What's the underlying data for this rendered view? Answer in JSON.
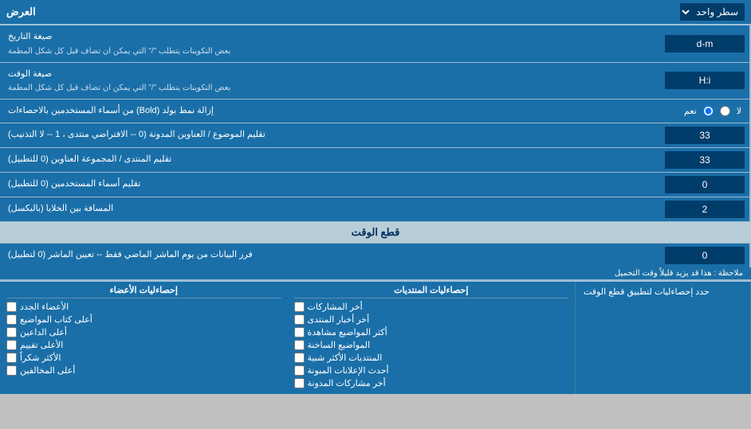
{
  "header": {
    "label": "العرض",
    "dropdown_label": "سطر واحد"
  },
  "rows": [
    {
      "id": "date-format",
      "label": "صيغة التاريخ",
      "sub_label": "بعض التكوينات يتطلب \"/\" التي يمكن ان تضاف قبل كل شكل المطمة",
      "input_value": "d-m",
      "input_type": "text"
    },
    {
      "id": "time-format",
      "label": "صيغة الوقت",
      "sub_label": "بعض التكوينات يتطلب \"/\" التي يمكن ان تضاف قبل كل شكل المطمة",
      "input_value": "H:i",
      "input_type": "text"
    },
    {
      "id": "bold-remove",
      "label": "إزالة نمط بولد (Bold) من أسماء المستخدمين بالاحصاءات",
      "radio_options": [
        "نعم",
        "لا"
      ],
      "radio_selected": "نعم"
    },
    {
      "id": "topic-limit",
      "label": "تقليم الموضوع / العناوين المدونة (0 -- الافتراضي منتدى ، 1 -- لا التذنيب)",
      "input_value": "33",
      "input_type": "text"
    },
    {
      "id": "forum-trim",
      "label": "تقليم المنتدى / المجموعة العناوين (0 للتطبيل)",
      "input_value": "33",
      "input_type": "text"
    },
    {
      "id": "username-trim",
      "label": "تقليم أسماء المستخدمين (0 للتطبيل)",
      "input_value": "0",
      "input_type": "text"
    },
    {
      "id": "cell-spacing",
      "label": "المسافة بين الخلايا (بالبكسل)",
      "input_value": "2",
      "input_type": "text"
    }
  ],
  "section_realtime": {
    "title": "قطع الوقت"
  },
  "realtime_row": {
    "label": "فرز البيانات من يوم الماشر الماضي فقط -- تعيين الماشر (0 لتطبيل)",
    "notice": "ملاحظة : هذا قد يزيد قليلاً وقت التحميل",
    "input_value": "0"
  },
  "apply_label": "حدد إحصاءليات لتطبيق قطع الوقت",
  "checkboxes": {
    "col1": {
      "header": "إحصاءليات المنتديات",
      "items": [
        "أخر المشاركات",
        "أخر أخبار المنتدى",
        "أكثر المواضيع مشاهدة",
        "المواضيع الساخنة",
        "المنتديات الأكثر شبية",
        "أحدث الإعلانات المبونة",
        "أخر مشاركات المدونة"
      ]
    },
    "col2": {
      "header": "إحصاءليات الأعضاء",
      "items": [
        "الأعضاء الجدد",
        "أعلى كتاب المواضيع",
        "أعلى الداعين",
        "الأعلى تقييم",
        "الأكثر شكراً",
        "أعلى المخالفين"
      ]
    }
  }
}
